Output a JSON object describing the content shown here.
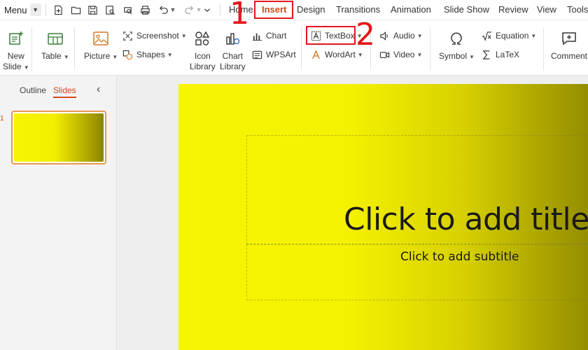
{
  "app": {
    "menu_label": "Menu",
    "quick_access_icons": [
      "new-icon",
      "open-icon",
      "save-icon",
      "print-preview-icon",
      "print-icon",
      "undo-icon",
      "redo-icon",
      "more-chevron-icon"
    ]
  },
  "tabs": [
    {
      "label": "Home",
      "active": false
    },
    {
      "label": "Insert",
      "active": true
    },
    {
      "label": "Design",
      "active": false
    },
    {
      "label": "Transitions",
      "active": false
    },
    {
      "label": "Animation",
      "active": false
    },
    {
      "label": "Slide Show",
      "active": false
    },
    {
      "label": "Review",
      "active": false
    },
    {
      "label": "View",
      "active": false
    },
    {
      "label": "Tools",
      "active": false
    }
  ],
  "ribbon": {
    "new_slide": {
      "line1": "New",
      "line2": "Slide"
    },
    "table": "Table",
    "picture": "Picture",
    "screenshot": "Screenshot",
    "shapes": "Shapes",
    "icon_library": {
      "line1": "Icon",
      "line2": "Library"
    },
    "chart_library": {
      "line1": "Chart",
      "line2": "Library"
    },
    "chart": "Chart",
    "wpsart": "WPSArt",
    "textbox": "TextBox",
    "wordart": "WordArt",
    "audio": "Audio",
    "video": "Video",
    "symbol": "Symbol",
    "equation": "Equation",
    "latex": "LaTeX",
    "comment": "Comment"
  },
  "annotations": {
    "step1": "1",
    "step2": "2"
  },
  "panel": {
    "tab_outline": "Outline",
    "tab_slides": "Slides",
    "slide_number": "1"
  },
  "slide": {
    "title_placeholder": "Click to add title",
    "subtitle_placeholder": "Click to add subtitle"
  },
  "colors": {
    "accent": "#d04a10",
    "annotation": "#e4161b",
    "slide_gradient_start": "#f7f500",
    "slide_gradient_end": "#8f8900"
  }
}
